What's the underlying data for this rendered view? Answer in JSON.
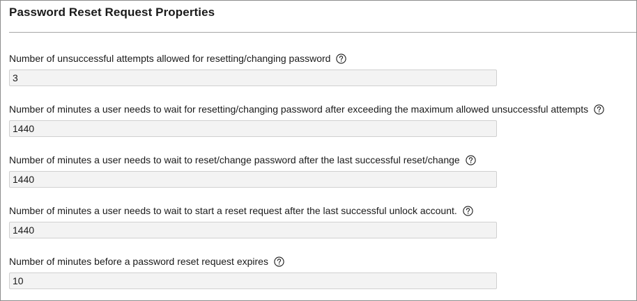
{
  "section": {
    "title": "Password Reset Request Properties"
  },
  "fields": [
    {
      "label": "Number of unsuccessful attempts allowed for resetting/changing password",
      "value": "3",
      "icon": "help-icon"
    },
    {
      "label": "Number of minutes a user needs to wait for resetting/changing password after exceeding the maximum allowed unsuccessful attempts",
      "value": "1440",
      "icon": "help-icon"
    },
    {
      "label": "Number of minutes a user needs to wait to reset/change password after the last successful reset/change",
      "value": "1440",
      "icon": "help-icon"
    },
    {
      "label": "Number of minutes a user needs to wait to start a reset request after the last successful unlock account.",
      "value": "1440",
      "icon": "help-icon"
    },
    {
      "label": "Number of minutes before a password reset request expires",
      "value": "10",
      "icon": "help-icon"
    }
  ]
}
